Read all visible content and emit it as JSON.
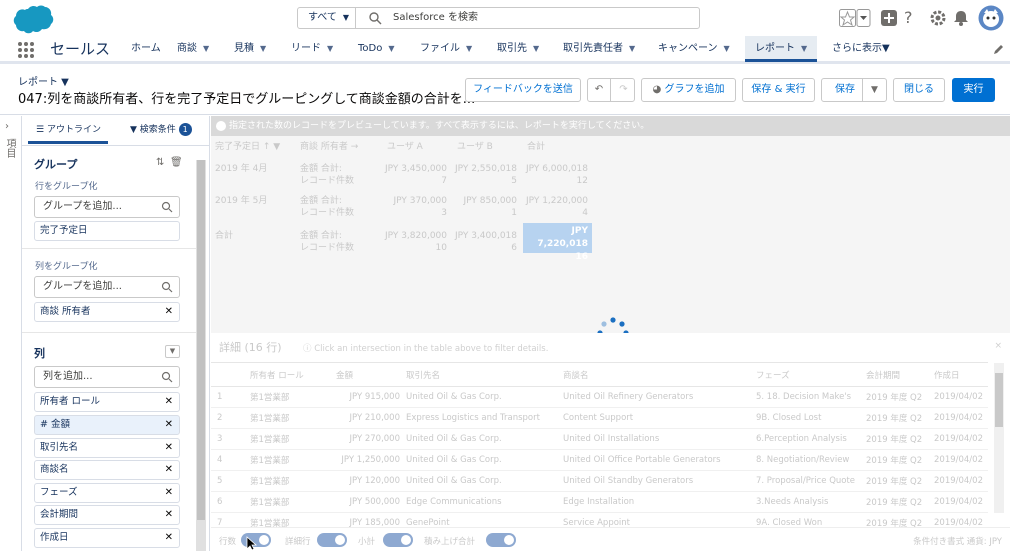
{
  "header": {
    "search_scope": "すべて",
    "search_placeholder": "Salesforce を検索"
  },
  "nav": {
    "app_name": "セールス",
    "tabs": [
      {
        "label": "ホーム",
        "chevron": false
      },
      {
        "label": "商談",
        "chevron": true
      },
      {
        "label": "見積",
        "chevron": true
      },
      {
        "label": "リード",
        "chevron": true
      },
      {
        "label": "ToDo",
        "chevron": true
      },
      {
        "label": "ファイル",
        "chevron": true
      },
      {
        "label": "取引先",
        "chevron": true
      },
      {
        "label": "取引先責任者",
        "chevron": true
      },
      {
        "label": "キャンペーン",
        "chevron": true
      },
      {
        "label": "レポート",
        "chevron": true,
        "active": true
      },
      {
        "label": "さらに表示▼",
        "chevron": false
      }
    ]
  },
  "titlebar": {
    "label": "レポート ▼",
    "title": "047:列を商談所有者、行を完了予定日でグルーピングして商談金額の合計を...",
    "buttons": {
      "feedback": "フィードバックを送信",
      "add_chart": "グラフを追加",
      "save_run": "保存 & 実行",
      "save": "保存",
      "close": "閉じる",
      "run": "実行"
    }
  },
  "sidebar": {
    "fields_tab": "項目",
    "outline_tab": "アウトライン",
    "filters_tab": "検索条件",
    "filters_count": "1",
    "group_title": "グループ",
    "group_rows_label": "行をグループ化",
    "group_rows_placeholder": "グループを追加...",
    "group_rows_items": [
      "完了予定日"
    ],
    "group_cols_label": "列をグループ化",
    "group_cols_placeholder": "グループを追加...",
    "group_cols_items": [
      "商談 所有者"
    ],
    "columns_title": "列",
    "columns_placeholder": "列を追加...",
    "columns_items": [
      "所有者 ロール",
      "# 金額",
      "取引先名",
      "商談名",
      "フェーズ",
      "会計期間",
      "作成日"
    ]
  },
  "main": {
    "info": "指定された数のレコードをプレビューしています。すべて表示するには、レポートを実行してください。",
    "summary": {
      "headers": [
        "完了予定日 ↑ ▼",
        "商談 所有者 →",
        "ユーザ A",
        "ユーザ B",
        "合計"
      ],
      "rows": [
        {
          "date": "2019 年 4月",
          "m1": "金額 合計:",
          "m2": "レコード件数",
          "a1": "JPY 3,450,000",
          "a2": "7",
          "b1": "JPY 2,550,018",
          "b2": "5",
          "t1": "JPY 6,000,018",
          "t2": "12"
        },
        {
          "date": "2019 年 5月",
          "m1": "金額 合計:",
          "m2": "レコード件数",
          "a1": "JPY 370,000",
          "a2": "3",
          "b1": "JPY 850,000",
          "b2": "1",
          "t1": "JPY 1,220,000",
          "t2": "4"
        },
        {
          "date": "合計",
          "m1": "金額 合計:",
          "m2": "レコード件数",
          "a1": "JPY 3,820,000",
          "a2": "10",
          "b1": "JPY 3,400,018",
          "b2": "6",
          "t1": "JPY 7,220,018",
          "t2": "16"
        }
      ]
    },
    "details_title": "詳細 (16 行)",
    "details_hint": "Click an intersection in the table above to filter details.",
    "details_close": "×",
    "detail_headers": [
      "",
      "所有者 ロール",
      "金額",
      "取引先名",
      "商談名",
      "フェーズ",
      "会計期間",
      "作成日"
    ],
    "detail_rows": [
      [
        "1",
        "第1営業部",
        "JPY 915,000",
        "United Oil & Gas Corp.",
        "United Oil Refinery Generators",
        "5. 18. Decision Make's",
        "2019 年度 Q2",
        "2019/04/02"
      ],
      [
        "2",
        "第1営業部",
        "JPY 210,000",
        "Express Logistics and Transport",
        "Content Support",
        "9B. Closed Lost",
        "2019 年度 Q2",
        "2019/04/02"
      ],
      [
        "3",
        "第1営業部",
        "JPY 270,000",
        "United Oil & Gas Corp.",
        "United Oil Installations",
        "6.Perception Analysis",
        "2019 年度 Q2",
        "2019/04/02"
      ],
      [
        "4",
        "第1営業部",
        "JPY 1,250,000",
        "United Oil & Gas Corp.",
        "United Oil Office Portable Generators",
        "8. Negotiation/Review",
        "2019 年度 Q2",
        "2019/04/02"
      ],
      [
        "5",
        "第1営業部",
        "JPY 120,000",
        "United Oil & Gas Corp.",
        "United Oil Standby Generators",
        "7. Proposal/Price Quote",
        "2019 年度 Q2",
        "2019/04/02"
      ],
      [
        "6",
        "第1営業部",
        "JPY 500,000",
        "Edge Communications",
        "Edge Installation",
        "3.Needs Analysis",
        "2019 年度 Q2",
        "2019/04/02"
      ],
      [
        "7",
        "第1営業部",
        "JPY 185,000",
        "GenePoint",
        "Service Appoint",
        "9A. Closed Won",
        "2019 年度 Q2",
        "2019/04/02"
      ]
    ]
  },
  "footer": {
    "toggles": [
      "行数",
      "詳細行",
      "小計",
      "積み上げ合計"
    ],
    "right": "条件付き書式  通貨: JPY"
  },
  "colors": {
    "brand": "#0070d2",
    "active_tab": "#1b5297"
  }
}
